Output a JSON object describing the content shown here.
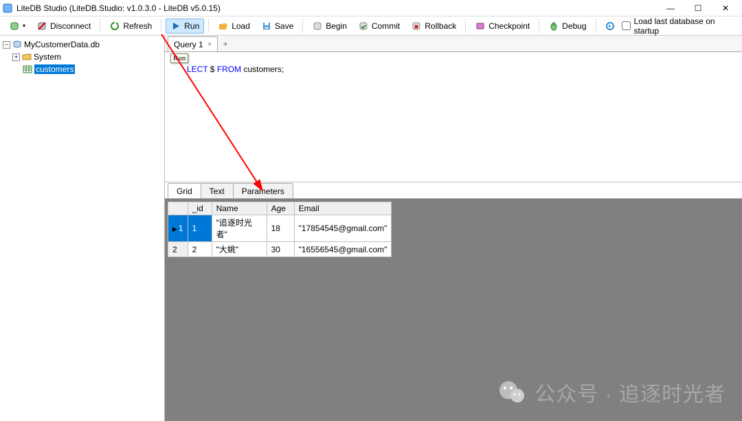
{
  "window": {
    "title": "LiteDB Studio (LiteDB.Studio: v1.0.3.0 - LiteDB v5.0.15)"
  },
  "toolbar": {
    "disconnect": "Disconnect",
    "refresh": "Refresh",
    "run": "Run",
    "load": "Load",
    "save": "Save",
    "begin": "Begin",
    "commit": "Commit",
    "rollback": "Rollback",
    "checkpoint": "Checkpoint",
    "debug": "Debug",
    "load_last": "Load last database on startup"
  },
  "tree": {
    "root": "MyCustomerData.db",
    "system": "System",
    "customers": "customers"
  },
  "query_tabs": {
    "tab1": "Query 1",
    "add": "+"
  },
  "editor": {
    "tooltip": "Run",
    "line1_partial": "LECT",
    "line1_dollar": " $ ",
    "line1_from": "FROM",
    "line1_rest": " customers;"
  },
  "result_tabs": {
    "grid": "Grid",
    "text": "Text",
    "parameters": "Parameters"
  },
  "grid": {
    "headers": {
      "blank": "",
      "id": "_id",
      "name": "Name",
      "age": "Age",
      "email": "Email"
    },
    "rows": [
      {
        "idx": "1",
        "_id": "1",
        "name": "\"追逐时光者\"",
        "age": "18",
        "email": "\"17854545@gmail.com\""
      },
      {
        "idx": "2",
        "_id": "2",
        "name": "\"大姚\"",
        "age": "30",
        "email": "\"16556545@gmail.com\""
      }
    ]
  },
  "watermark": {
    "text": "公众号 · 追逐时光者"
  }
}
